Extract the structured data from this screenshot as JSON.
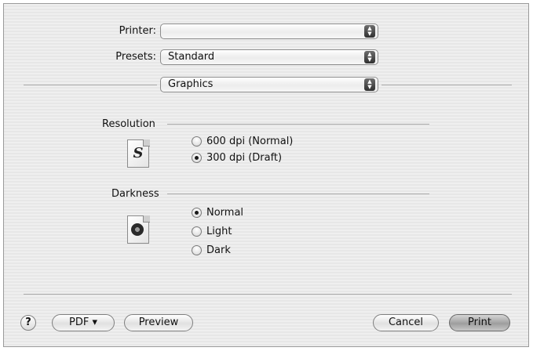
{
  "dialog": {
    "printer": {
      "label": "Printer:",
      "value": ""
    },
    "presets": {
      "label": "Presets:",
      "value": "Standard"
    },
    "panel": {
      "value": "Graphics"
    },
    "resolution": {
      "label": "Resolution",
      "icon": "s-document-icon",
      "options": [
        {
          "label": "600 dpi (Normal)",
          "checked": false
        },
        {
          "label": "300 dpi (Draft)",
          "checked": true
        }
      ]
    },
    "darkness": {
      "label": "Darkness",
      "icon": "darkness-document-icon",
      "options": [
        {
          "label": "Normal",
          "checked": true
        },
        {
          "label": "Light",
          "checked": false
        },
        {
          "label": "Dark",
          "checked": false
        }
      ]
    },
    "buttons": {
      "help": "?",
      "pdf": "PDF ▾",
      "preview": "Preview",
      "cancel": "Cancel",
      "print": "Print"
    }
  }
}
